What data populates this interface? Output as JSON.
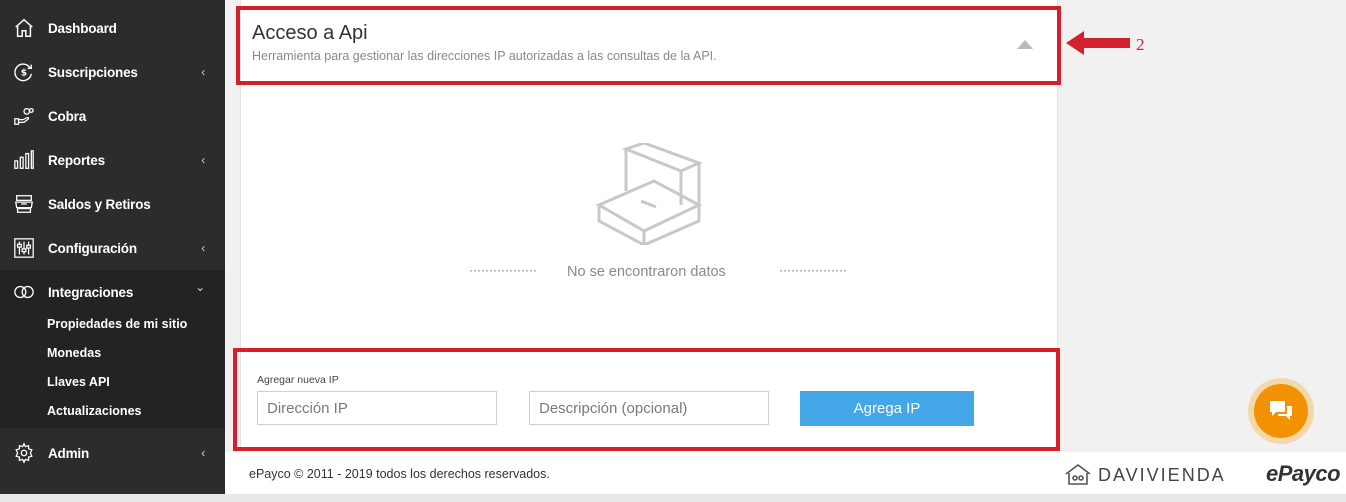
{
  "sidebar": {
    "items": [
      {
        "label": "Dashboard",
        "icon": "home-icon"
      },
      {
        "label": "Suscripciones",
        "icon": "dollar-circle-icon",
        "chevron": "‹"
      },
      {
        "label": "Cobra",
        "icon": "hand-coin-icon"
      },
      {
        "label": "Reportes",
        "icon": "bar-chart-icon",
        "chevron": "‹"
      },
      {
        "label": "Saldos y Retiros",
        "icon": "cash-register-icon"
      },
      {
        "label": "Configuración",
        "icon": "sliders-icon",
        "chevron": "‹"
      },
      {
        "label": "Integraciones",
        "icon": "rings-icon",
        "chevron": "⌄"
      },
      {
        "label": "Admin",
        "icon": "cog-icon",
        "chevron": "‹"
      }
    ],
    "sub_items": [
      {
        "label": "Propiedades de mi sitio"
      },
      {
        "label": "Monedas"
      },
      {
        "label": "Llaves API"
      },
      {
        "label": "Actualizaciones"
      }
    ]
  },
  "panel": {
    "title": "Acceso a Api",
    "subtitle": "Herramienta para gestionar las direcciones IP autorizadas a las consultas de la API.",
    "annotation_number": "2",
    "empty_state": {
      "dots_left": "·················",
      "dots_right": "·················",
      "text": "No se encontraron datos"
    }
  },
  "form": {
    "label": "Agregar nueva IP",
    "ip_placeholder": "Dirección IP",
    "description_placeholder": "Descripción (opcional)",
    "submit_label": "Agrega IP"
  },
  "footer": {
    "copyright": "ePayco © 2011 - 2019 todos los derechos reservados.",
    "partner_name": "DAVIVIENDA",
    "brand_name": "ePayco"
  },
  "colors": {
    "sidebar_bg": "#2c2c2c",
    "highlight_red": "#d4202c",
    "button_blue": "#44a8e8",
    "chat_orange": "#f39200"
  }
}
